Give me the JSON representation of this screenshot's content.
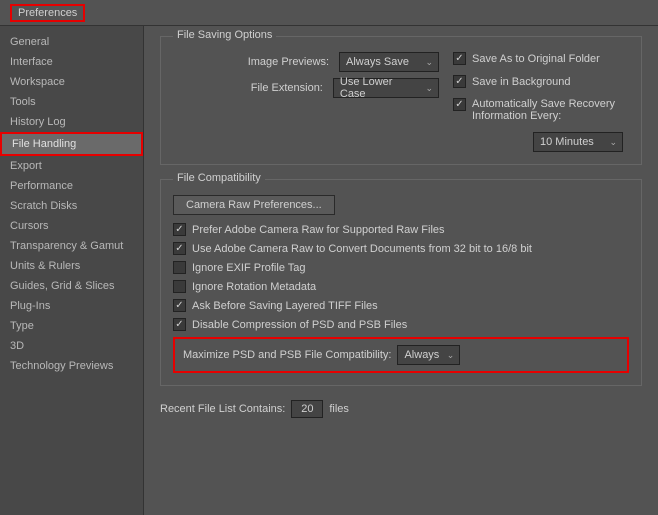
{
  "title": "Preferences",
  "sidebar": {
    "items": [
      {
        "label": "General"
      },
      {
        "label": "Interface"
      },
      {
        "label": "Workspace"
      },
      {
        "label": "Tools"
      },
      {
        "label": "History Log"
      },
      {
        "label": "File Handling",
        "selected": true,
        "highlight": true
      },
      {
        "label": "Export"
      },
      {
        "label": "Performance"
      },
      {
        "label": "Scratch Disks"
      },
      {
        "label": "Cursors"
      },
      {
        "label": "Transparency & Gamut"
      },
      {
        "label": "Units & Rulers"
      },
      {
        "label": "Guides, Grid & Slices"
      },
      {
        "label": "Plug-Ins"
      },
      {
        "label": "Type"
      },
      {
        "label": "3D"
      },
      {
        "label": "Technology Previews"
      }
    ]
  },
  "fileSaving": {
    "title": "File Saving Options",
    "imagePreviewsLabel": "Image Previews:",
    "imagePreviewsValue": "Always Save",
    "fileExtensionLabel": "File Extension:",
    "fileExtensionValue": "Use Lower Case",
    "saveOriginal": "Save As to Original Folder",
    "saveBackground": "Save in Background",
    "autoSaveRecovery": "Automatically Save Recovery Information Every:",
    "recoveryInterval": "10 Minutes"
  },
  "fileCompat": {
    "title": "File Compatibility",
    "cameraRawBtn": "Camera Raw Preferences...",
    "preferAdobe": "Prefer Adobe Camera Raw for Supported Raw Files",
    "useAdobe": "Use Adobe Camera Raw to Convert Documents from 32 bit to 16/8 bit",
    "ignoreExif": "Ignore EXIF Profile Tag",
    "ignoreRotation": "Ignore Rotation Metadata",
    "askTiff": "Ask Before Saving Layered TIFF Files",
    "disableCompression": "Disable Compression of PSD and PSB Files",
    "maxCompatLabel": "Maximize PSD and PSB File Compatibility:",
    "maxCompatValue": "Always"
  },
  "recentFiles": {
    "label": "Recent File List Contains:",
    "value": "20",
    "suffix": "files"
  }
}
